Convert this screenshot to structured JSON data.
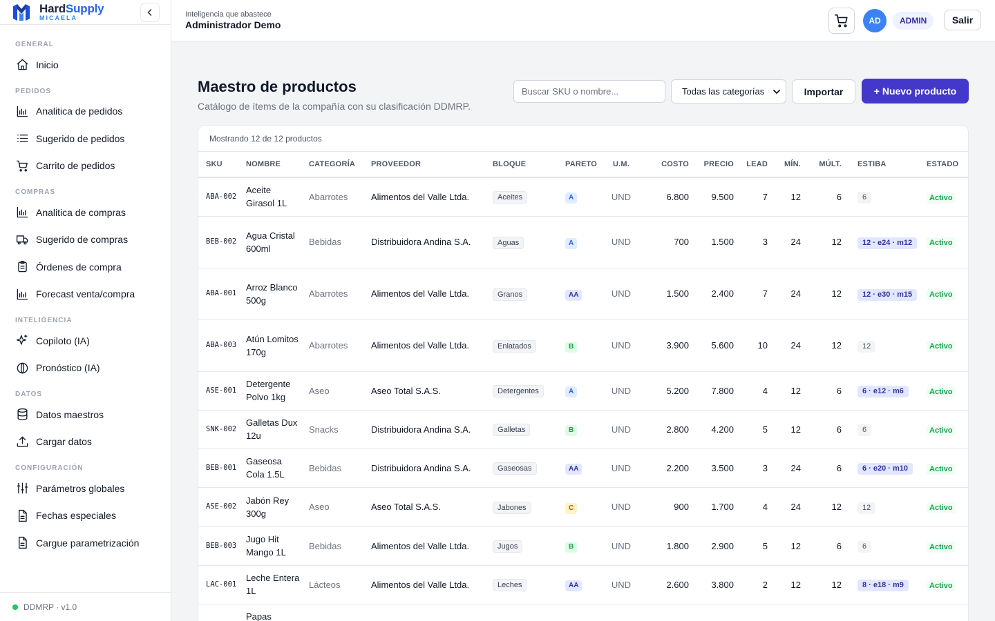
{
  "brand": {
    "name_part1": "Hard",
    "name_part2": "Supply",
    "sub": "MICAELA"
  },
  "sidebar": {
    "sections": [
      {
        "title": "GENERAL",
        "items": [
          {
            "label": "Inicio",
            "icon": "home-icon"
          }
        ]
      },
      {
        "title": "PEDIDOS",
        "items": [
          {
            "label": "Analitica de pedidos",
            "icon": "bar-chart-icon"
          },
          {
            "label": "Sugerido de pedidos",
            "icon": "list-icon"
          },
          {
            "label": "Carrito de pedidos",
            "icon": "cart-icon"
          }
        ]
      },
      {
        "title": "COMPRAS",
        "items": [
          {
            "label": "Analitica de compras",
            "icon": "bar-chart-icon"
          },
          {
            "label": "Sugerido de compras",
            "icon": "truck-icon"
          },
          {
            "label": "Órdenes de compra",
            "icon": "clipboard-icon"
          },
          {
            "label": "Forecast venta/compra",
            "icon": "bar-chart-icon"
          }
        ]
      },
      {
        "title": "INTELIGENCIA",
        "items": [
          {
            "label": "Copiloto (IA)",
            "icon": "sparkle-icon"
          },
          {
            "label": "Pronóstico (IA)",
            "icon": "globe-icon"
          }
        ]
      },
      {
        "title": "DATOS",
        "items": [
          {
            "label": "Datos maestros",
            "icon": "database-icon"
          },
          {
            "label": "Cargar datos",
            "icon": "upload-icon"
          }
        ]
      },
      {
        "title": "CONFIGURACIÓN",
        "items": [
          {
            "label": "Parámetros globales",
            "icon": "sliders-icon"
          },
          {
            "label": "Fechas especiales",
            "icon": "file-icon"
          },
          {
            "label": "Cargue parametrización",
            "icon": "file-icon"
          }
        ]
      }
    ],
    "footer": "DDMRP · v1.0"
  },
  "topbar": {
    "subtitle": "Inteligencia que abastece",
    "title": "Administrador Demo",
    "avatar": "AD",
    "role": "ADMIN",
    "logout": "Salir"
  },
  "page": {
    "title": "Maestro de productos",
    "subtitle": "Catálogo de ítems de la compañía con su clasificación DDMRP.",
    "search_placeholder": "Buscar SKU o nombre...",
    "category_select": "Todas las categorías",
    "import_label": "Importar",
    "new_label": "+ Nuevo producto",
    "showing": "Mostrando 12 de 12 productos"
  },
  "table": {
    "headers": [
      "SKU",
      "NOMBRE",
      "CATEGORÍA",
      "PROVEEDOR",
      "BLOQUE",
      "PARETO",
      "U.M.",
      "COSTO",
      "PRECIO",
      "LEAD",
      "MÍN.",
      "MÚLT.",
      "ESTIBA",
      "ESTADO"
    ],
    "rows": [
      {
        "sku": "ABA-002",
        "name": "Aceite Girasol 1L",
        "category": "Abarrotes",
        "supplier": "Alimentos del Valle Ltda.",
        "block": "Aceites",
        "pareto": "A",
        "um": "UND",
        "cost": "6.800",
        "price": "9.500",
        "lead": "7",
        "min": "12",
        "mult": "6",
        "estiba": "6",
        "estiba_strong": false,
        "status": "Activo"
      },
      {
        "sku": "BEB-002",
        "name": "Agua Cristal 600ml",
        "category": "Bebidas",
        "supplier": "Distribuidora Andina S.A.",
        "block": "Aguas",
        "pareto": "A",
        "um": "UND",
        "cost": "700",
        "price": "1.500",
        "lead": "3",
        "min": "24",
        "mult": "12",
        "estiba": "12 · e24 · m12",
        "estiba_strong": true,
        "status": "Activo"
      },
      {
        "sku": "ABA-001",
        "name": "Arroz Blanco 500g",
        "category": "Abarrotes",
        "supplier": "Alimentos del Valle Ltda.",
        "block": "Granos",
        "pareto": "AA",
        "um": "UND",
        "cost": "1.500",
        "price": "2.400",
        "lead": "7",
        "min": "24",
        "mult": "12",
        "estiba": "12 · e30 · m15",
        "estiba_strong": true,
        "status": "Activo"
      },
      {
        "sku": "ABA-003",
        "name": "Atún Lomitos 170g",
        "category": "Abarrotes",
        "supplier": "Alimentos del Valle Ltda.",
        "block": "Enlatados",
        "pareto": "B",
        "um": "UND",
        "cost": "3.900",
        "price": "5.600",
        "lead": "10",
        "min": "24",
        "mult": "12",
        "estiba": "12",
        "estiba_strong": false,
        "status": "Activo"
      },
      {
        "sku": "ASE-001",
        "name": "Detergente Polvo 1kg",
        "category": "Aseo",
        "supplier": "Aseo Total S.A.S.",
        "block": "Detergentes",
        "pareto": "A",
        "um": "UND",
        "cost": "5.200",
        "price": "7.800",
        "lead": "4",
        "min": "12",
        "mult": "6",
        "estiba": "6 · e12 · m6",
        "estiba_strong": true,
        "status": "Activo"
      },
      {
        "sku": "SNK-002",
        "name": "Galletas Dux 12u",
        "category": "Snacks",
        "supplier": "Distribuidora Andina S.A.",
        "block": "Galletas",
        "pareto": "B",
        "um": "UND",
        "cost": "2.800",
        "price": "4.200",
        "lead": "5",
        "min": "12",
        "mult": "6",
        "estiba": "6",
        "estiba_strong": false,
        "status": "Activo"
      },
      {
        "sku": "BEB-001",
        "name": "Gaseosa Cola 1.5L",
        "category": "Bebidas",
        "supplier": "Distribuidora Andina S.A.",
        "block": "Gaseosas",
        "pareto": "AA",
        "um": "UND",
        "cost": "2.200",
        "price": "3.500",
        "lead": "3",
        "min": "24",
        "mult": "6",
        "estiba": "6 · e20 · m10",
        "estiba_strong": true,
        "status": "Activo"
      },
      {
        "sku": "ASE-002",
        "name": "Jabón Rey 300g",
        "category": "Aseo",
        "supplier": "Aseo Total S.A.S.",
        "block": "Jabones",
        "pareto": "C",
        "um": "UND",
        "cost": "900",
        "price": "1.700",
        "lead": "4",
        "min": "24",
        "mult": "12",
        "estiba": "12",
        "estiba_strong": false,
        "status": "Activo"
      },
      {
        "sku": "BEB-003",
        "name": "Jugo Hit Mango 1L",
        "category": "Bebidas",
        "supplier": "Alimentos del Valle Ltda.",
        "block": "Jugos",
        "pareto": "B",
        "um": "UND",
        "cost": "1.800",
        "price": "2.900",
        "lead": "5",
        "min": "12",
        "mult": "6",
        "estiba": "6",
        "estiba_strong": false,
        "status": "Activo"
      },
      {
        "sku": "LAC-001",
        "name": "Leche Entera 1L",
        "category": "Lácteos",
        "supplier": "Alimentos del Valle Ltda.",
        "block": "Leches",
        "pareto": "AA",
        "um": "UND",
        "cost": "2.600",
        "price": "3.800",
        "lead": "2",
        "min": "12",
        "mult": "12",
        "estiba": "8 · e18 · m9",
        "estiba_strong": true,
        "status": "Activo"
      },
      {
        "sku": "",
        "name": "Papas",
        "category": "",
        "supplier": "",
        "block": "",
        "pareto": "",
        "um": "",
        "cost": "",
        "price": "",
        "lead": "",
        "min": "",
        "mult": "",
        "estiba": "",
        "estiba_strong": false,
        "status": ""
      }
    ]
  }
}
